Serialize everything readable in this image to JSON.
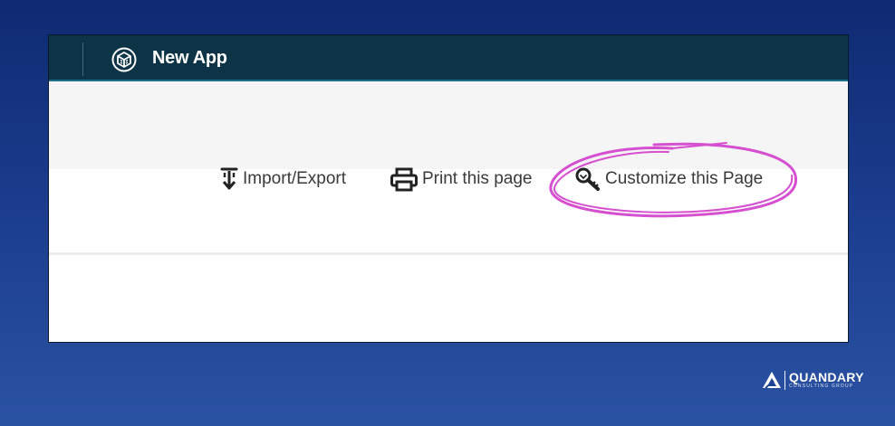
{
  "app": {
    "title": "New App"
  },
  "toolbar": {
    "import_export_label": "Import/Export",
    "print_label": "Print this page",
    "customize_label": "Customize this Page"
  },
  "annotation": {
    "highlight_color": "#d64fd0",
    "highlighted_item": "customize"
  },
  "brand": {
    "name": "QUANDARY",
    "tagline": "CONSULTING GROUP"
  },
  "colors": {
    "topbar": "#0c3446",
    "background_gradient_top": "#0e2a72",
    "background_gradient_bottom": "#2a52a3"
  },
  "icons": [
    "app-cube-icon",
    "download-icon",
    "printer-icon",
    "magnify-key-icon",
    "quandary-logo-icon"
  ]
}
